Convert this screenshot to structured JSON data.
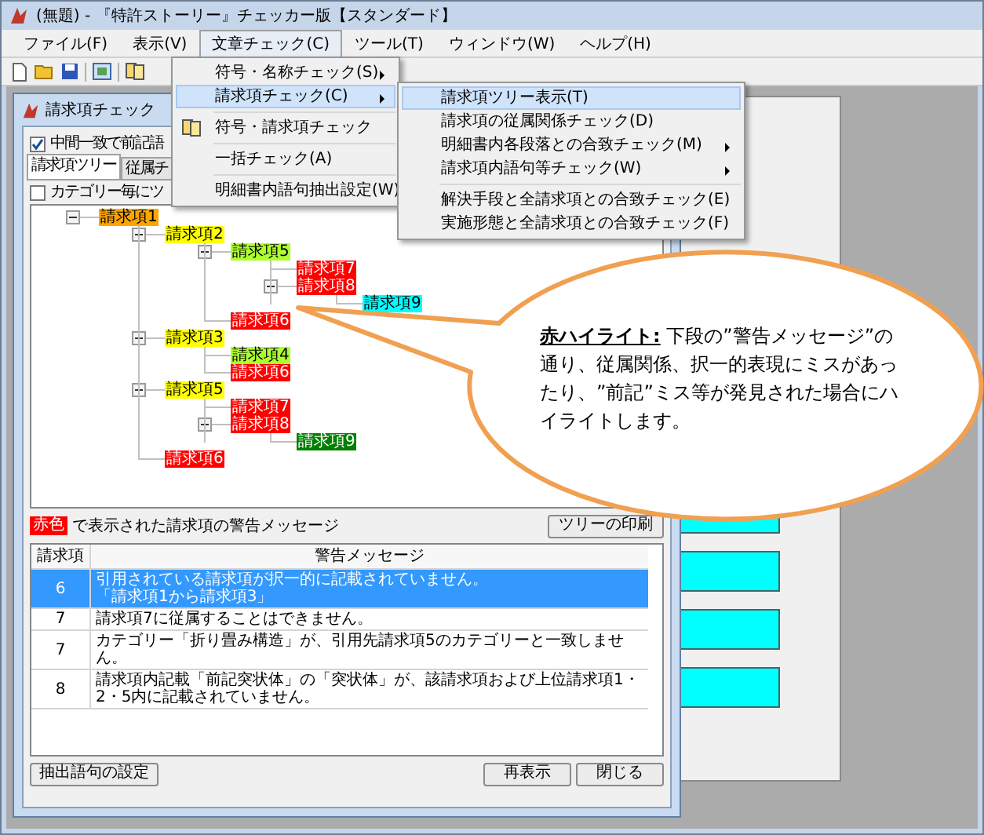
{
  "window": {
    "title": "(無題) - 『特許ストーリー』チェッカー版【スタンダード】"
  },
  "menubar": [
    {
      "label": "ファイル(F)",
      "selected": false
    },
    {
      "label": "表示(V)",
      "selected": false
    },
    {
      "label": "文章チェック(C)",
      "selected": true
    },
    {
      "label": "ツール(T)",
      "selected": false
    },
    {
      "label": "ウィンドウ(W)",
      "selected": false
    },
    {
      "label": "ヘルプ(H)",
      "selected": false
    }
  ],
  "menu": [
    {
      "kind": "item",
      "label": "符号・名称チェック(S)",
      "submenu": true,
      "selected": false
    },
    {
      "kind": "item",
      "label": "請求項チェック(C)",
      "submenu": true,
      "selected": true
    },
    {
      "kind": "separator"
    },
    {
      "kind": "item",
      "label": "符号・請求項チェック",
      "submenu": false,
      "selected": false,
      "icon": true
    },
    {
      "kind": "separator"
    },
    {
      "kind": "item",
      "label": "一括チェック(A)",
      "submenu": false,
      "selected": false
    },
    {
      "kind": "separator"
    },
    {
      "kind": "item",
      "label": "明細書内語句抽出設定(W)",
      "submenu": false,
      "selected": false
    }
  ],
  "submenu": [
    {
      "kind": "item",
      "label": "請求項ツリー表示(T)",
      "submenu": false,
      "selected": true
    },
    {
      "kind": "item",
      "label": "請求項の従属関係チェック(D)",
      "submenu": false,
      "selected": false
    },
    {
      "kind": "item",
      "label": "明細書内各段落との合致チェック(M)",
      "submenu": true,
      "selected": false
    },
    {
      "kind": "item",
      "label": "請求項内語句等チェック(W)",
      "submenu": true,
      "selected": false
    },
    {
      "kind": "separator"
    },
    {
      "kind": "item",
      "label": "解決手段と全請求項との合致チェック(E)",
      "submenu": false,
      "selected": false
    },
    {
      "kind": "item",
      "label": "実施形態と全請求項との合致チェック(F)",
      "submenu": false,
      "selected": false
    }
  ],
  "dialog": {
    "title": "請求項チェック",
    "option": {
      "label": "中間一致で前記語",
      "checked": true
    },
    "tabs": [
      {
        "label": "請求項ツリー",
        "selected": true
      },
      {
        "label": "従属チ",
        "selected": false
      }
    ],
    "category_option": {
      "label": "カテゴリー毎にツ",
      "checked": false
    },
    "tree": [
      {
        "label": "請求項1",
        "color": "#ffa500",
        "expanded": true,
        "children": [
          {
            "label": "請求項2",
            "color": "#ffff00",
            "expanded": true,
            "children": [
              {
                "label": "請求項5",
                "color": "#adff2f",
                "expanded": true,
                "children": [
                  {
                    "label": "請求項7",
                    "color": "#ff0000"
                  },
                  {
                    "label": "請求項8",
                    "color": "#ff0000",
                    "expanded": true,
                    "children": [
                      {
                        "label": "請求項9",
                        "color": "#00ffff"
                      }
                    ]
                  }
                ]
              },
              {
                "label": "請求項6",
                "color": "#ff0000"
              }
            ]
          },
          {
            "label": "請求項3",
            "color": "#ffff00",
            "expanded": true,
            "children": [
              {
                "label": "請求項4",
                "color": "#adff2f"
              },
              {
                "label": "請求項6",
                "color": "#ff0000"
              }
            ]
          },
          {
            "label": "請求項5",
            "color": "#ffff00",
            "expanded": true,
            "children": [
              {
                "label": "請求項7",
                "color": "#ff0000"
              },
              {
                "label": "請求項8",
                "color": "#ff0000",
                "expanded": true,
                "children": [
                  {
                    "label": "請求項9",
                    "color": "#008000"
                  }
                ]
              }
            ]
          },
          {
            "label": "請求項6",
            "color": "#ff0000"
          }
        ]
      }
    ],
    "legend": {
      "badge": "赤色",
      "text": "で表示された請求項の警告メッセージ"
    },
    "print_button": "ツリーの印刷",
    "table": {
      "columns": [
        "請求項",
        "警告メッセージ"
      ],
      "rows": [
        {
          "claim": "6",
          "message": [
            "引用されている請求項が択一的に記載されていません。",
            "「請求項1から請求項3」"
          ],
          "selected": true
        },
        {
          "claim": "7",
          "message": [
            "請求項7に従属することはできません。"
          ],
          "selected": false
        },
        {
          "claim": "7",
          "message": [
            "カテゴリー「折り畳み構造」が、引用先請求項5のカテゴリーと一致しません。"
          ],
          "selected": false
        },
        {
          "claim": "8",
          "message": [
            "請求項内記載「前記突状体」の「突状体」が、該請求項および上位請求項1・2・5内に記載されていません。"
          ],
          "selected": false
        }
      ]
    },
    "buttons": {
      "left": "抽出語句の設定",
      "right": [
        "再表示",
        "閉じる"
      ]
    }
  },
  "callout": {
    "text": "**赤ハイライト:** 下段の”警告メッセージ”の通り、従属関係、択一的表現にミスがあったり、”前記”ミス等が発見された場合にハイライトします。"
  }
}
